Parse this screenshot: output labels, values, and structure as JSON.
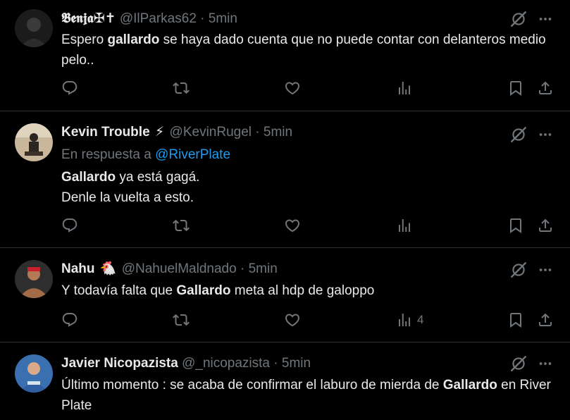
{
  "colors": {
    "background": "#000000",
    "text": "#e7e9ea",
    "muted": "#71767b",
    "link": "#1d9bf0",
    "divider": "#2f3336"
  },
  "tweets": [
    {
      "name": "𝕭𝖊𝖓𝖏𝖆✠✝",
      "handle": "@IlParkas62",
      "separator": "·",
      "time": "5min",
      "text_parts": [
        "Espero ",
        "gallardo",
        " se haya dado cuenta que no puede contar con delanteros medio pelo.."
      ],
      "views": ""
    },
    {
      "name": "Kevin Trouble",
      "emoji": "⚡",
      "handle": "@KevinRugel",
      "separator": "·",
      "time": "5min",
      "reply_prefix": "En respuesta a ",
      "reply_to": "@RiverPlate",
      "text_line1_bold": "Gallardo",
      "text_line1_rest": " ya está gagá.",
      "text_line2": "Denle la vuelta a esto.",
      "views": ""
    },
    {
      "name": "Nahu",
      "emoji": "🐔",
      "handle": "@NahuelMaldnado",
      "separator": "·",
      "time": "5min",
      "text_parts": [
        "Y todavía falta que ",
        "Gallardo",
        " meta al hdp de galoppo"
      ],
      "views": "4"
    },
    {
      "name": "Javier Nicopazista",
      "handle": "@_nicopazista",
      "separator": "·",
      "time": "5min",
      "text_parts": [
        "Último momento : se acaba de confirmar el laburo de mierda de ",
        "Gallardo",
        " en River Plate"
      ],
      "views": ""
    }
  ],
  "icons": {
    "grok": "grok-icon",
    "more": "more-icon",
    "reply": "reply-icon",
    "retweet": "retweet-icon",
    "like": "like-icon",
    "views": "views-icon",
    "bookmark": "bookmark-icon",
    "share": "share-icon"
  }
}
